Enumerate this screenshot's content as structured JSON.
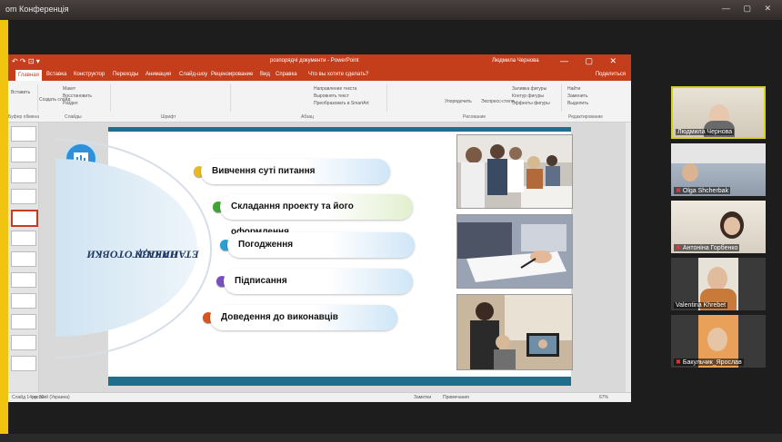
{
  "zoom": {
    "window_title": "om Конференція",
    "window_controls": "— ▢ ✕"
  },
  "ppt": {
    "quick_access": "↶ ↷ ⊡ ▾",
    "doc_title": "розпорядчі документи - PowerPoint",
    "user": "Людмила Чернова",
    "window_controls": "— ▢ ✕",
    "tabs": [
      "Главная",
      "Вставка",
      "Конструктор",
      "Переходы",
      "Анимация",
      "Слайд-шоу",
      "Рецензирование",
      "Вид",
      "Справка",
      "Что вы хотите сделать?"
    ],
    "share": "Поделиться",
    "ribbon": {
      "groups": [
        "Буфер обмена",
        "Слайды",
        "Шрифт",
        "Абзац",
        "Рисование",
        "Редактирование"
      ],
      "items": [
        "Вставить",
        "Создать слайд",
        "Макет",
        "Восстановить",
        "Раздел",
        "Направление текста",
        "Выровнять текст",
        "Преобразовать в SmartArt",
        "Упорядочить",
        "Экспресс-стили",
        "Заливка фигуры",
        "Контур фигуры",
        "Эффекты фигуры",
        "Найти",
        "Заменить",
        "Выделить"
      ]
    },
    "status": {
      "slide_info": "Слайд 14 из 33",
      "language": "русский (Украина)",
      "notes": "Заметки",
      "comments": "Примечания",
      "zoom": "67%"
    }
  },
  "slide": {
    "side_title_line1": "ЕТАПИ ПІДГОТОВКИ",
    "side_title_line2": "НАКАЗУ",
    "steps": [
      {
        "label": "Вивчення суті питання",
        "color": "#e8b923"
      },
      {
        "label": "Складання проекту та його оформлення",
        "color": "#3fa535"
      },
      {
        "label": "Погодження",
        "color": "#2a9fd6"
      },
      {
        "label": "Підписання",
        "color": "#7a4fc0"
      },
      {
        "label": "Доведення до виконавців",
        "color": "#d9541e"
      }
    ]
  },
  "participants": [
    {
      "name": "Людмила Чернова",
      "muted": false,
      "active": true
    },
    {
      "name": "Olga Shcherbak",
      "muted": true,
      "active": false
    },
    {
      "name": "Антоніна Горбенко",
      "muted": true,
      "active": false
    },
    {
      "name": "Valentina Khrebet",
      "muted": false,
      "active": false
    },
    {
      "name": "Бакульчик_Ярослав",
      "muted": true,
      "active": false
    }
  ],
  "colors": {
    "ppt_accent": "#c43e1c",
    "slide_band": "#1f6e8c",
    "active_speaker": "#d6d21e",
    "muted_icon": "#e23b3b"
  }
}
